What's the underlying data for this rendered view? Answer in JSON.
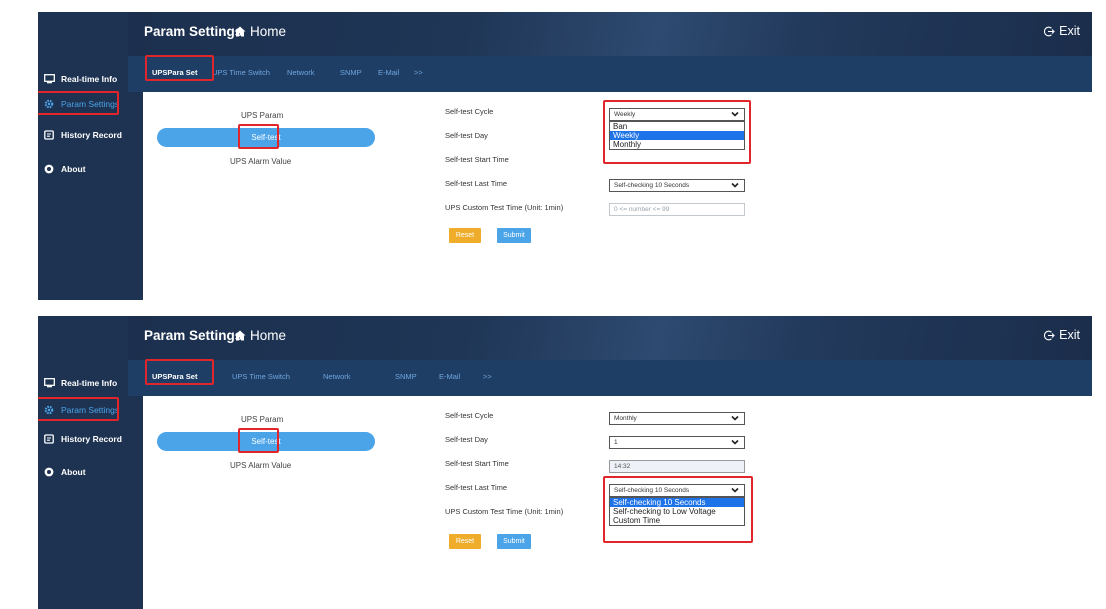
{
  "app": {
    "page_title": "Param Settings",
    "home_label": "Home",
    "exit_label": "Exit"
  },
  "sidebar": {
    "items": [
      {
        "label": "Real-time Info",
        "icon": "monitor-icon"
      },
      {
        "label": "Param Settings",
        "icon": "gear-icon"
      },
      {
        "label": "History Record",
        "icon": "history-icon"
      },
      {
        "label": "About",
        "icon": "info-icon"
      }
    ]
  },
  "tabs": [
    "UPSPara Set",
    "UPS Time Switch",
    "Network",
    "SNMP",
    "E-Mail",
    ">>"
  ],
  "subnav": {
    "ups_param": "UPS Param",
    "self_test": "Self-test",
    "ups_alarm_value": "UPS Alarm Value"
  },
  "form": {
    "labels": {
      "cycle": "Self-test Cycle",
      "day": "Self-test Day",
      "start_time": "Self-test Start Time",
      "last_time": "Self-test Last Time",
      "custom_time": "UPS Custom Test Time (Unit: 1min)"
    },
    "custom_placeholder": "0 <= number <= 99",
    "reset_label": "Reset",
    "submit_label": "Submit"
  },
  "screen1": {
    "cycle_value": "Weekly",
    "last_time_value": "Self-checking 10 Seconds",
    "cycle_options": [
      "Ban",
      "Weekly",
      "Monthly"
    ],
    "cycle_selected_option": "Weekly"
  },
  "screen2": {
    "cycle_value": "Monthly",
    "day_value": "1",
    "start_time_value": "14:32",
    "last_time_value": "Self-checking 10 Seconds",
    "last_time_options": [
      "Self-checking 10 Seconds",
      "Self-checking to Low Voltage",
      "Custom Time"
    ],
    "last_time_selected_option": "Self-checking 10 Seconds"
  },
  "colors": {
    "sidebar_bg": "#1e3352",
    "accent_blue": "#4ba3e8",
    "reset_orange": "#f0ad2b",
    "highlight_red": "#e0262b"
  }
}
